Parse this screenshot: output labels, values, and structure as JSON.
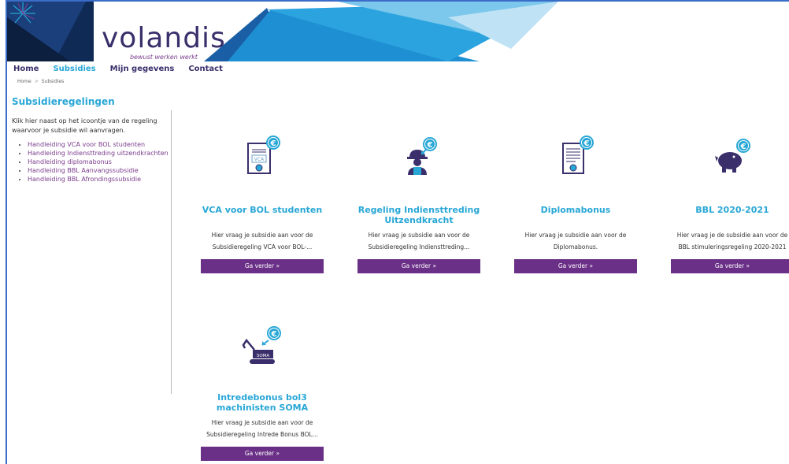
{
  "brand": {
    "logo_text": "volandis",
    "tagline": "bewust werken werkt",
    "colors": {
      "primary": "#3a2f6b",
      "accent": "#28a7d6",
      "button": "#6a2f86",
      "link": "#7a3c8c"
    }
  },
  "nav": {
    "items": [
      {
        "label": "Home",
        "active": false
      },
      {
        "label": "Subsidies",
        "active": true
      },
      {
        "label": "Mijn gegevens",
        "active": false
      },
      {
        "label": "Contact",
        "active": false
      }
    ]
  },
  "breadcrumb": {
    "home": "Home",
    "separator": ">",
    "current": "Subsidies"
  },
  "sidebar": {
    "title": "Subsidieregelingen",
    "intro": "Klik hier naast op het icoontje van de regeling waarvoor je subsidie wil aanvragen.",
    "links": [
      "Handleiding VCA voor BOL studenten",
      "Handleiding Indiensttreding uitzendkrachten",
      "Handleiding diplomabonus",
      "Handleiding BBL Aanvangssubsidie",
      "Handleiding BBL Afrondingssubsidie"
    ]
  },
  "cards": [
    {
      "icon": "vca-certificate-icon",
      "title": "VCA voor BOL studenten",
      "desc_line1": "Hier vraag je subsidie aan voor de",
      "desc_line2": "Subsidieregeling VCA voor BOL-...",
      "button": "Ga verder »"
    },
    {
      "icon": "construction-worker-icon",
      "title": "Regeling Indiensttreding Uitzendkracht",
      "desc_line1": "Hier vraag je subsidie aan voor de",
      "desc_line2": "Subsidieregeling Indiensttreding...",
      "button": "Ga verder »"
    },
    {
      "icon": "diploma-certificate-icon",
      "title": "Diplomabonus",
      "desc_line1": "Hier vraag je subsidie aan voor de",
      "desc_line2": "Diplomabonus.",
      "button": "Ga verder »"
    },
    {
      "icon": "piggy-bank-icon",
      "title": "BBL 2020-2021",
      "desc_line1": "Hier vraag je de subsidie aan voor de",
      "desc_line2": "BBL stimuleringsregeling 2020-2021",
      "button": "Ga verder »"
    },
    {
      "icon": "excavator-soma-icon",
      "icon_label": "SOMA",
      "title": "Intredebonus bol3 machinisten SOMA",
      "desc_line1": "Hier vraag je subsidie aan voor de",
      "desc_line2": "Subsidieregeling Intrede Bonus BOL...",
      "button": "Ga verder »"
    }
  ],
  "euro_symbol": "€"
}
